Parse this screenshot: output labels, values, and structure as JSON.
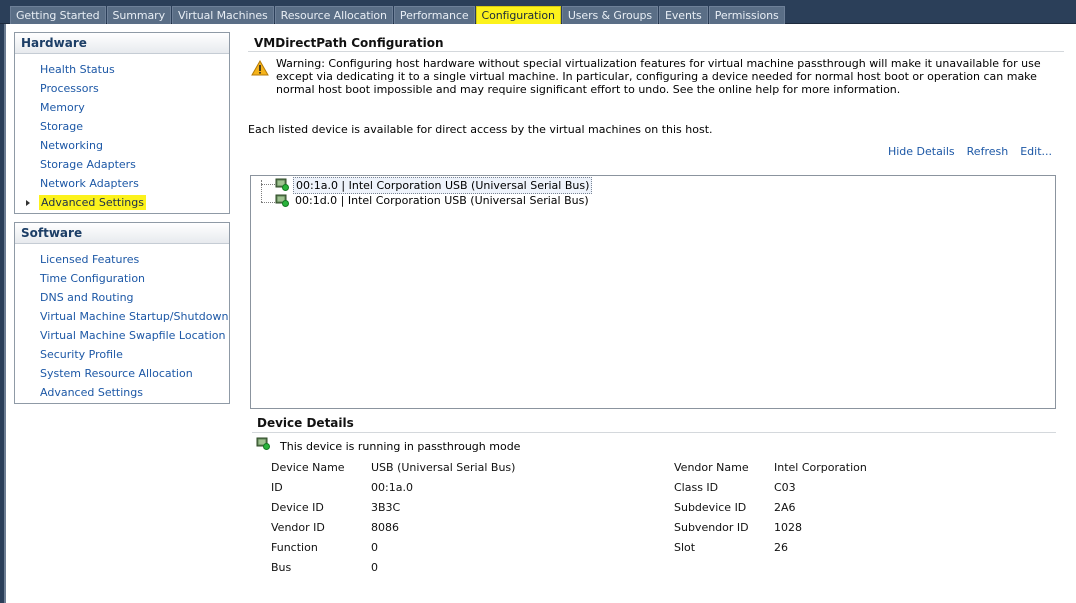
{
  "tabs": [
    {
      "label": "Getting Started",
      "active": false
    },
    {
      "label": "Summary",
      "active": false
    },
    {
      "label": "Virtual Machines",
      "active": false
    },
    {
      "label": "Resource Allocation",
      "active": false
    },
    {
      "label": "Performance",
      "active": false
    },
    {
      "label": "Configuration",
      "active": true
    },
    {
      "label": "Users & Groups",
      "active": false
    },
    {
      "label": "Events",
      "active": false
    },
    {
      "label": "Permissions",
      "active": false
    }
  ],
  "hardware": {
    "title": "Hardware",
    "items": [
      {
        "label": "Health Status"
      },
      {
        "label": "Processors"
      },
      {
        "label": "Memory"
      },
      {
        "label": "Storage"
      },
      {
        "label": "Networking"
      },
      {
        "label": "Storage Adapters"
      },
      {
        "label": "Network Adapters"
      },
      {
        "label": "Advanced Settings",
        "selected": true
      }
    ]
  },
  "software": {
    "title": "Software",
    "items": [
      {
        "label": "Licensed Features"
      },
      {
        "label": "Time Configuration"
      },
      {
        "label": "DNS and Routing"
      },
      {
        "label": "Virtual Machine Startup/Shutdown"
      },
      {
        "label": "Virtual Machine Swapfile Location"
      },
      {
        "label": "Security Profile"
      },
      {
        "label": "System Resource Allocation"
      },
      {
        "label": "Advanced Settings"
      }
    ]
  },
  "main": {
    "heading": "VMDirectPath Configuration",
    "warning": "Warning: Configuring host hardware without special virtualization features for virtual machine passthrough will make it unavailable for use except via dedicating it to a single virtual machine. In particular, configuring a device needed for normal host boot or operation can make normal host boot impossible and may require significant effort to undo. See the online help for more information.",
    "available_text": "Each listed device is available for direct access by the virtual machines on this host.",
    "actions": {
      "hide_details": "Hide Details",
      "refresh": "Refresh",
      "edit": "Edit..."
    },
    "devices": [
      {
        "label": "00:1a.0 | Intel Corporation USB (Universal Serial Bus)",
        "selected": true
      },
      {
        "label": "00:1d.0 | Intel Corporation USB (Universal Serial Bus)",
        "selected": false
      }
    ]
  },
  "device_details": {
    "title": "Device Details",
    "status": "This device is running in passthrough mode",
    "left": [
      {
        "key": "Device Name",
        "value": "USB (Universal Serial Bus)"
      },
      {
        "key": "ID",
        "value": "00:1a.0"
      },
      {
        "key": "Device ID",
        "value": "3B3C"
      },
      {
        "key": "Vendor ID",
        "value": "8086"
      },
      {
        "key": "Function",
        "value": "0"
      },
      {
        "key": "Bus",
        "value": "0"
      }
    ],
    "right": [
      {
        "key": "Vendor Name",
        "value": "Intel Corporation"
      },
      {
        "key": "Class ID",
        "value": "C03"
      },
      {
        "key": "Subdevice ID",
        "value": "2A6"
      },
      {
        "key": "Subvendor ID",
        "value": "1028"
      },
      {
        "key": "Slot",
        "value": "26"
      }
    ]
  },
  "icons": {
    "warning": "warning-icon",
    "device": "pci-device-passthrough-icon"
  },
  "colors": {
    "tabbar": "#2b3f59",
    "active_tab": "#fcf21c",
    "link": "#1d58a6",
    "highlight": "#fcf21c"
  }
}
